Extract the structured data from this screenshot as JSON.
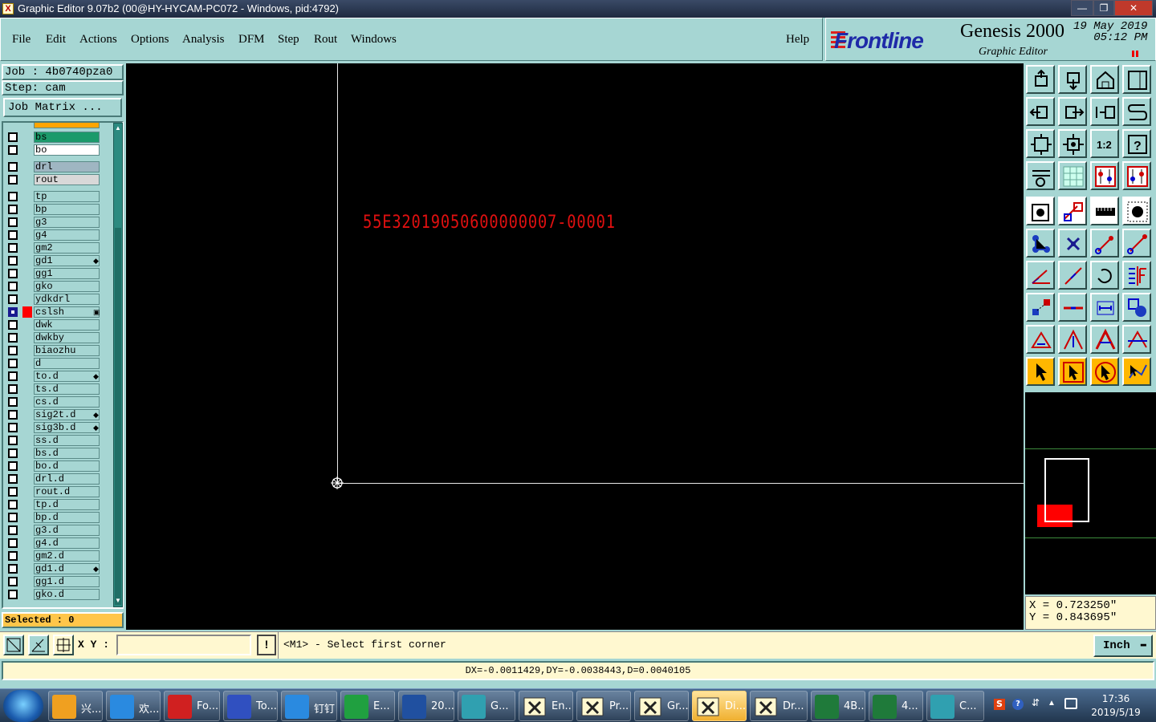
{
  "window": {
    "title": "Graphic Editor 9.07b2 (00@HY-HYCAM-PC072 - Windows, pid:4792)",
    "controls": [
      "—",
      "❐",
      "✕"
    ]
  },
  "menu": [
    "File",
    "Edit",
    "Actions",
    "Options",
    "Analysis",
    "DFM",
    "Step",
    "Rout",
    "Windows"
  ],
  "help": "Help",
  "brand": {
    "logo": "Frontline",
    "product": "Genesis 2000",
    "subtitle": "Graphic Editor",
    "date": "19  May  2019",
    "time": "05:12  PM"
  },
  "job": {
    "job_label": "Job : 4b0740pza0",
    "step_label": "Step: cam",
    "matrix_button": "Job Matrix ..."
  },
  "layers": [
    {
      "name": "bs",
      "color": "#1b9a6a"
    },
    {
      "name": "bo",
      "color": "#ffffff"
    },
    {
      "name": "drl",
      "color": "#9fb6c2"
    },
    {
      "name": "rout",
      "color": "#d8d8d8"
    },
    {
      "name": "tp"
    },
    {
      "name": "bp"
    },
    {
      "name": "g3"
    },
    {
      "name": "g4"
    },
    {
      "name": "gm2"
    },
    {
      "name": "gd1",
      "mark": "◆"
    },
    {
      "name": "gg1"
    },
    {
      "name": "gko"
    },
    {
      "name": "ydkdrl"
    },
    {
      "name": "cslsh",
      "active": true,
      "mark": "▣"
    },
    {
      "name": "dwk"
    },
    {
      "name": "dwkby"
    },
    {
      "name": "biaozhu"
    },
    {
      "name": "d"
    },
    {
      "name": "to.d",
      "mark": "◆"
    },
    {
      "name": "ts.d"
    },
    {
      "name": "cs.d"
    },
    {
      "name": "sig2t.d",
      "mark": "◆"
    },
    {
      "name": "sig3b.d",
      "mark": "◆"
    },
    {
      "name": "ss.d"
    },
    {
      "name": "bs.d"
    },
    {
      "name": "bo.d"
    },
    {
      "name": "drl.d"
    },
    {
      "name": "rout.d"
    },
    {
      "name": "tp.d"
    },
    {
      "name": "bp.d"
    },
    {
      "name": "g3.d"
    },
    {
      "name": "g4.d"
    },
    {
      "name": "gm2.d"
    },
    {
      "name": "gd1.d",
      "mark": "◆"
    },
    {
      "name": "gg1.d"
    },
    {
      "name": "gko.d"
    }
  ],
  "selected": "Selected : 0",
  "canvas": {
    "text": "55E32019050600000007-00001",
    "text_color": "#e01010"
  },
  "coords": {
    "x": "X = 0.723250\"",
    "y": "Y = 0.843695\""
  },
  "bottom": {
    "xy_label": "X Y :",
    "xy_value": "",
    "prompt": "<M1> - Select first corner",
    "unit": "Inch"
  },
  "status": "DX=-0.0011429,DY=-0.0038443,D=0.0040105",
  "taskbar": {
    "items": [
      {
        "label": "兴...",
        "icon": "shell-icon",
        "color": "#f0a020"
      },
      {
        "label": "欢...",
        "icon": "ie-icon",
        "color": "#2a8ae0"
      },
      {
        "label": "Fo...",
        "icon": "foxit-icon",
        "color": "#d02020"
      },
      {
        "label": "To...",
        "icon": "floppy-icon",
        "color": "#3050c0"
      },
      {
        "label": "钉钉",
        "icon": "dingtalk-icon",
        "color": "#2a8ae0"
      },
      {
        "label": "E...",
        "icon": "frontline-f-icon",
        "color": "#20a040"
      },
      {
        "label": "20...",
        "icon": "word-icon",
        "color": "#2050a0"
      },
      {
        "label": "G...",
        "icon": "genesis-icon",
        "color": "#30a0b0"
      },
      {
        "label": "En...",
        "icon": "x-window-icon",
        "color": "#fff8d0"
      },
      {
        "label": "Pr...",
        "icon": "x-window-icon",
        "color": "#fff8d0"
      },
      {
        "label": "Gr...",
        "icon": "x-window-icon",
        "color": "#fff8d0"
      },
      {
        "label": "Di...",
        "icon": "x-window-icon",
        "color": "#fff8d0",
        "active": true
      },
      {
        "label": "Dr...",
        "icon": "x-window-icon",
        "color": "#fff8d0"
      },
      {
        "label": "4B...",
        "icon": "excel-icon",
        "color": "#1f7a3a"
      },
      {
        "label": "4...",
        "icon": "excel-icon",
        "color": "#1f7a3a"
      },
      {
        "label": "C...",
        "icon": "genesis-icon",
        "color": "#30a0b0"
      }
    ],
    "time": "17:36",
    "date": "2019/5/19"
  }
}
